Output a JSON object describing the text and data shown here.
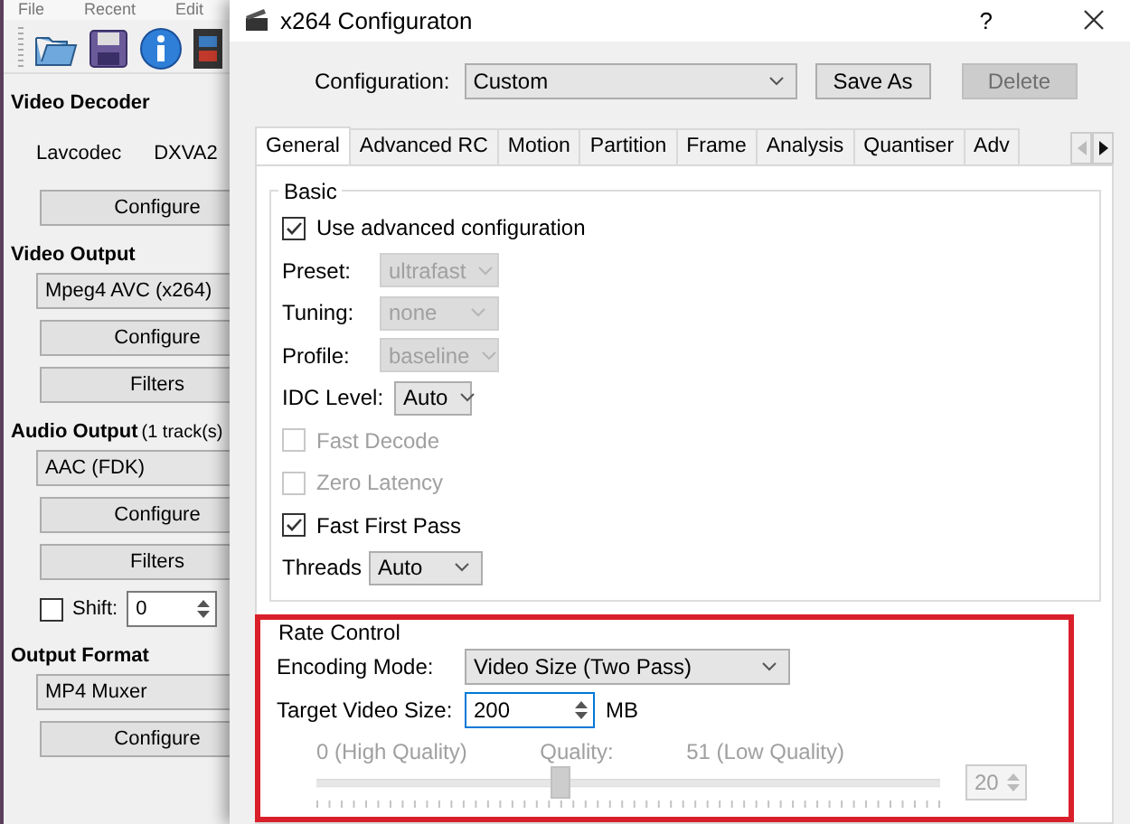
{
  "menu": [
    "File",
    "Recent",
    "Edit"
  ],
  "side_panel": {
    "sections": [
      {
        "title": "Video Decoder",
        "items": [
          {
            "kind": "labels",
            "texts": [
              "Lavcodec",
              "DXVA2"
            ]
          },
          {
            "kind": "button",
            "label": "Configure"
          }
        ]
      },
      {
        "title": "Video Output",
        "items": [
          {
            "kind": "combo",
            "value": "Mpeg4 AVC (x264)"
          },
          {
            "kind": "button",
            "label": "Configure"
          },
          {
            "kind": "button",
            "label": "Filters"
          }
        ]
      },
      {
        "title": "Audio Output",
        "note": "(1 track(s)",
        "items": [
          {
            "kind": "combo",
            "value": "AAC (FDK)"
          },
          {
            "kind": "button",
            "label": "Configure"
          },
          {
            "kind": "button",
            "label": "Filters"
          },
          {
            "kind": "shift",
            "label": "Shift:",
            "checked": false,
            "value": "0"
          }
        ]
      },
      {
        "title": "Output Format",
        "items": [
          {
            "kind": "combo",
            "value": "MP4 Muxer"
          },
          {
            "kind": "button",
            "label": "Configure"
          }
        ]
      }
    ]
  },
  "dialog": {
    "title": "x264 Configuraton",
    "help": "?",
    "configuration": {
      "label": "Configuration:",
      "value": "Custom"
    },
    "buttons": [
      {
        "label": "Save As",
        "disabled": false
      },
      {
        "label": "Delete",
        "disabled": true
      }
    ],
    "tabs": [
      {
        "label": "General",
        "selected": true
      },
      {
        "label": "Advanced RC",
        "selected": false
      },
      {
        "label": "Motion",
        "selected": false
      },
      {
        "label": "Partition",
        "selected": false
      },
      {
        "label": "Frame",
        "selected": false
      },
      {
        "label": "Analysis",
        "selected": false
      },
      {
        "label": "Quantiser",
        "selected": false
      },
      {
        "label": "Adv",
        "selected": false
      }
    ],
    "basic": {
      "title": "Basic",
      "rows": [
        {
          "kind": "check",
          "label": "Use advanced configuration",
          "checked": true,
          "disabled": false
        },
        {
          "kind": "combo",
          "label": "Preset:",
          "value": "ultrafast",
          "disabled": true
        },
        {
          "kind": "combo",
          "label": "Tuning:",
          "value": "none",
          "disabled": true
        },
        {
          "kind": "combo",
          "label": "Profile:",
          "value": "baseline",
          "disabled": true
        },
        {
          "kind": "combo",
          "label": "IDC Level:",
          "value": "Auto",
          "disabled": false
        },
        {
          "kind": "check",
          "label": "Fast Decode",
          "checked": false,
          "disabled": true
        },
        {
          "kind": "check",
          "label": "Zero Latency",
          "checked": false,
          "disabled": true
        },
        {
          "kind": "check",
          "label": "Fast First Pass",
          "checked": true,
          "disabled": false
        },
        {
          "kind": "combo",
          "label": "Threads",
          "value": "Auto",
          "disabled": false
        }
      ]
    },
    "rate_control": {
      "title": "Rate Control",
      "highlighted": true,
      "encoding_mode": {
        "label": "Encoding Mode:",
        "value": "Video Size (Two Pass)"
      },
      "target": {
        "label": "Target Video Size:",
        "value": "200",
        "unit": "MB"
      },
      "quality": {
        "min_label": "0 (High Quality)",
        "label": "Quality:",
        "max_label": "51 (Low Quality)",
        "level": 0.39,
        "value": "20",
        "disabled": true
      }
    }
  }
}
